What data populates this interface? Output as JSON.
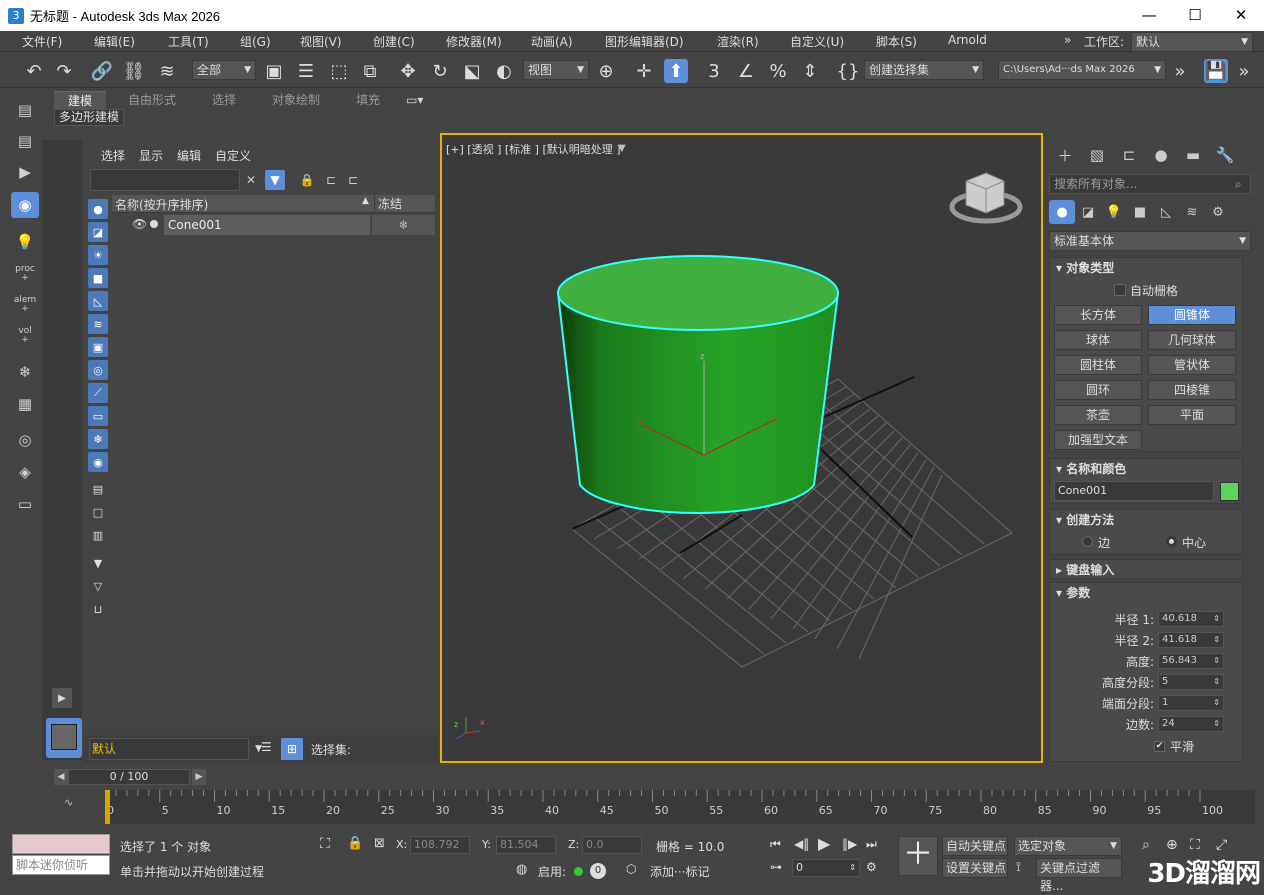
{
  "window": {
    "title": "无标题 - Autodesk 3ds Max 2026",
    "app_icon": "3",
    "minimize": "—",
    "maximize": "☐",
    "close": "✕"
  },
  "menubar": {
    "items": [
      "文件(F)",
      "编辑(E)",
      "工具(T)",
      "组(G)",
      "视图(V)",
      "创建(C)",
      "修改器(M)",
      "动画(A)",
      "图形编辑器(D)",
      "渲染(R)",
      "自定义(U)",
      "脚本(S)",
      "Arnold"
    ],
    "more": "»",
    "workspace_label": "工作区:",
    "workspace_value": "默认"
  },
  "toolbar": {
    "filter_value": "全部",
    "refcoord_value": "视图",
    "selset_value": "创建选择集",
    "path_value": "C:\\Users\\Ad···ds Max 2026"
  },
  "ribbon": {
    "tabs": [
      "建模",
      "自由形式",
      "选择",
      "对象绘制",
      "填充"
    ],
    "sub_label": "多边形建模"
  },
  "scene_explorer": {
    "menu": [
      "选择",
      "显示",
      "编辑",
      "自定义"
    ],
    "col_name": "名称(按升序排序)",
    "col_frozen": "冻结",
    "sort_arrow": "▲",
    "row_name": "Cone001",
    "frozen_glyph": "❄",
    "layer_value": "默认",
    "selset_label": "选择集:"
  },
  "viewport": {
    "label": "[+] [透视 ] [标准 ] [默认明暗处理 ]",
    "object_color": "#2e9c2e",
    "highlight_color": "#33ffff"
  },
  "command_panel": {
    "search_placeholder": "搜索所有对象...",
    "category": "标准基本体",
    "rollout_object_type": "对象类型",
    "autogrid": "自动栅格",
    "buttons": [
      "长方体",
      "圆锥体",
      "球体",
      "几何球体",
      "圆柱体",
      "管状体",
      "圆环",
      "四棱锥",
      "茶壶",
      "平面",
      "加强型文本"
    ],
    "rollout_name_color": "名称和颜色",
    "name_value": "Cone001",
    "swatch_color": "#5fd35f",
    "rollout_creation": "创建方法",
    "method_edge": "边",
    "method_center": "中心",
    "rollout_keyboard": "键盘输入",
    "rollout_params": "参数",
    "params": [
      {
        "label": "半径 1:",
        "value": "40.618"
      },
      {
        "label": "半径 2:",
        "value": "41.618"
      },
      {
        "label": "高度:",
        "value": "56.843"
      },
      {
        "label": "高度分段:",
        "value": "5"
      },
      {
        "label": "端面分段:",
        "value": "1"
      },
      {
        "label": "边数:",
        "value": "24"
      }
    ],
    "smooth": "平滑"
  },
  "timeline": {
    "slider_text": "0 / 100",
    "ticks": [
      "0",
      "5",
      "10",
      "15",
      "20",
      "25",
      "30",
      "35",
      "40",
      "45",
      "50",
      "55",
      "60",
      "65",
      "70",
      "75",
      "80",
      "85",
      "90",
      "95",
      "100"
    ]
  },
  "status": {
    "script_placeholder": "脚本迷你侦听",
    "selected": "选择了 1 个 对象",
    "prompt": "单击并拖动以开始创建过程",
    "x_label": "X:",
    "x_value": "108.792",
    "y_label": "Y:",
    "y_value": "81.504",
    "z_label": "Z:",
    "z_value": "0.0",
    "grid": "栅格 = 10.0",
    "enable": "启用:",
    "add_tag": "添加···标记",
    "autokey": "自动关键点",
    "selected_obj": "选定对象",
    "setkey": "设置关键点",
    "keyfilter": "关键点过滤器...",
    "frame_value": "0",
    "watermark": "3D溜溜网"
  }
}
